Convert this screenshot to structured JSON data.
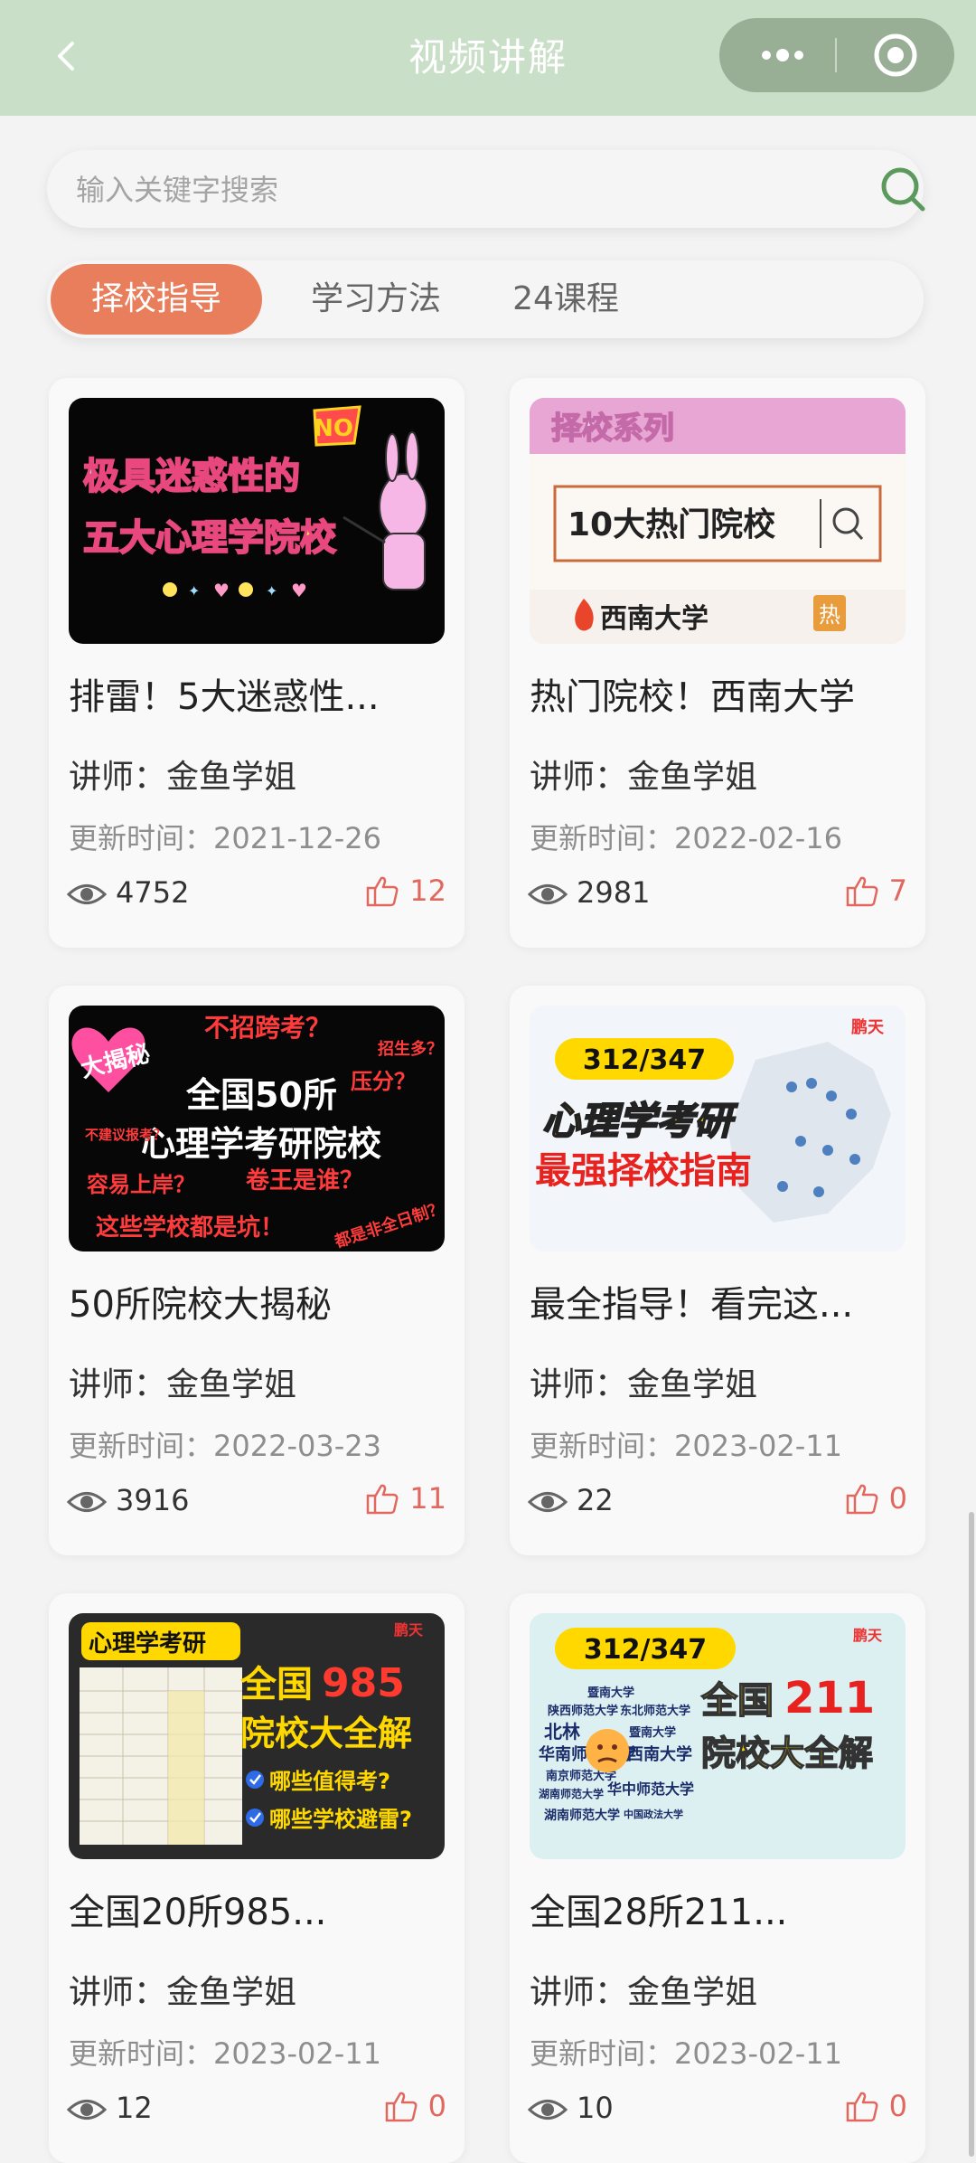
{
  "header": {
    "title": "视频讲解"
  },
  "search": {
    "placeholder": "输入关键字搜索"
  },
  "tabs": [
    {
      "label": "择校指导",
      "active": true
    },
    {
      "label": "学习方法",
      "active": false
    },
    {
      "label": "24课程",
      "active": false
    }
  ],
  "colors": {
    "accent": "#e97e5d",
    "nav": "#c9dfc7",
    "like": "#e0685f",
    "search_icon": "#5b9a5c"
  },
  "cards": [
    {
      "title": "排雷！5大迷惑性...",
      "teacher": "讲师：金鱼学姐",
      "date": "更新时间：2021-12-26",
      "views": "4752",
      "likes": "12",
      "thumb": {
        "line1": "极具迷惑性的",
        "line2": "五大心理学院校",
        "badge": "NO"
      }
    },
    {
      "title": "热门院校！西南大学",
      "teacher": "讲师：金鱼学姐",
      "date": "更新时间：2022-02-16",
      "views": "2981",
      "likes": "7",
      "thumb": {
        "header": "择校系列",
        "search_text": "10大热门院校",
        "school": "西南大学",
        "tag": "热"
      }
    },
    {
      "title": "50所院校大揭秘",
      "teacher": "讲师：金鱼学姐",
      "date": "更新时间：2022-03-23",
      "views": "3916",
      "likes": "11",
      "thumb": {
        "heart_text": "大揭秘",
        "line1": "全国50所",
        "line2": "心理学考研院校",
        "q1": "不招跨考？",
        "q2": "压分？",
        "q3": "招生多？",
        "q4": "容易上岸？",
        "q5": "卷王是谁？",
        "q6": "这些学校都是坑！",
        "q7": "不建议报考？",
        "q8": "都是非全日制？"
      }
    },
    {
      "title": "最全指导！看完这...",
      "teacher": "讲师：金鱼学姐",
      "date": "更新时间：2023-02-11",
      "views": "22",
      "likes": "0",
      "thumb": {
        "code": "312/347",
        "line1": "心理学考研",
        "line2": "最强择校指南",
        "brand": "鹏天"
      }
    },
    {
      "title": "全国20所985...",
      "teacher": "讲师：金鱼学姐",
      "date": "更新时间：2023-02-11",
      "views": "12",
      "likes": "0",
      "thumb": {
        "tag": "心理学考研",
        "line1a": "全国",
        "line1b": "985",
        "line2": "院校大全解",
        "q1": "哪些值得考?",
        "q2": "哪些学校避雷?",
        "brand": "鹏天"
      }
    },
    {
      "title": "全国28所211...",
      "teacher": "讲师：金鱼学姐",
      "date": "更新时间：2023-02-11",
      "views": "10",
      "likes": "0",
      "thumb": {
        "code": "312/347",
        "line1a": "全国",
        "line1b": "211",
        "line2": "院校大全解",
        "brand": "鹏天",
        "schools": [
          "暨南大学",
          "陕西师范大学",
          "东北师范大学",
          "北林",
          "暨南大学",
          "华南师范大学",
          "西南大学",
          "南京师范大学",
          "湖南师范大学",
          "华中师范大学",
          "湖南师范大学",
          "中国政法大学"
        ]
      }
    }
  ]
}
